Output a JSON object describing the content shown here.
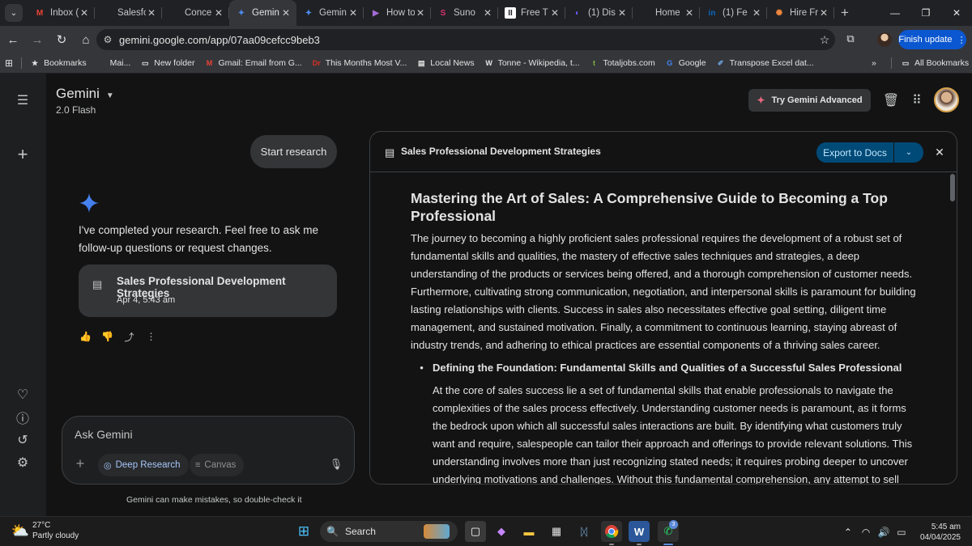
{
  "browser": {
    "tabs": [
      {
        "title": "Inbox (",
        "favicon": "M",
        "color": "#ea4335"
      },
      {
        "title": "Salesfo",
        "favicon": "",
        "color": "#202124"
      },
      {
        "title": "Conce",
        "favicon": "",
        "color": "#202124"
      },
      {
        "title": "Gemin",
        "favicon": "✦",
        "color": "#4c8df6",
        "active": true
      },
      {
        "title": "Gemin",
        "favicon": "✦",
        "color": "#4c8df6"
      },
      {
        "title": "How to",
        "favicon": "▶",
        "color": "#a46bd6"
      },
      {
        "title": "Suno",
        "favicon": "S",
        "color": "#d6336c"
      },
      {
        "title": "Free T",
        "favicon": "II",
        "color": "#ffffff"
      },
      {
        "title": "(1) Dis",
        "favicon": "◐",
        "color": "#6a5cff"
      },
      {
        "title": "Home",
        "favicon": "𝕏",
        "color": "#202124"
      },
      {
        "title": "(1) Fe",
        "favicon": "in",
        "color": "#0a66c2"
      },
      {
        "title": "Hire Fr",
        "favicon": "✺",
        "color": "#f0883e"
      }
    ],
    "url": "gemini.google.com/app/07aa09cefcc9beb3",
    "finish_update": "Finish update",
    "bookmarks": [
      {
        "label": "Bookmarks",
        "icon": "★",
        "color": "#e3e3e3"
      },
      {
        "label": "Mai...",
        "icon": "",
        "color": "#35363a"
      },
      {
        "label": "New folder",
        "icon": "▭",
        "color": "#e3e3e3"
      },
      {
        "label": "Gmail: Email from G...",
        "icon": "M",
        "color": "#ea4335"
      },
      {
        "label": "This Months Most V...",
        "icon": "Dr",
        "color": "#d93025"
      },
      {
        "label": "Local News",
        "icon": "▤",
        "color": "#e3e3e3"
      },
      {
        "label": "Tonne - Wikipedia, t...",
        "icon": "W",
        "color": "#e3e3e3"
      },
      {
        "label": "Totaljobs.com",
        "icon": "t",
        "color": "#7cb342"
      },
      {
        "label": "Google",
        "icon": "G",
        "color": "#4285f4"
      },
      {
        "label": "Transpose Excel dat...",
        "icon": "✐",
        "color": "#6aa0d8"
      }
    ],
    "bookmarks_more": "»",
    "all_bookmarks": "All Bookmarks"
  },
  "app": {
    "brand": "Gemini",
    "model": "2.0 Flash",
    "try_advanced": "Try Gemini Advanced"
  },
  "chat": {
    "user_message": "Start research",
    "reply": "I've completed your research. Feel free to ask me follow-up questions or request changes.",
    "doc_card": {
      "title": "Sales Professional Development Strategies",
      "date": "Apr 4, 5:43 am"
    },
    "input_placeholder": "Ask Gemini",
    "deep_research": "Deep Research",
    "canvas": "Canvas",
    "disclaimer": "Gemini can make mistakes, so double-check it"
  },
  "panel": {
    "title": "Sales Professional Development Strategies",
    "export": "Export to Docs",
    "heading": "Mastering the Art of Sales: A Comprehensive Guide to Becoming a Top Professional",
    "intro": "The journey to becoming a highly proficient sales professional requires the development of a robust set of fundamental skills and qualities, the mastery of effective sales techniques and strategies, a deep understanding of the products or services being offered, and a thorough comprehension of customer needs. Furthermore, cultivating strong communication, negotiation, and interpersonal skills is paramount for building lasting relationships with clients. Success in sales also necessitates effective goal setting, diligent time management, and sustained motivation. Finally, a commitment to continuous learning, staying abreast of industry trends, and adhering to ethical practices are essential components of a thriving sales career.",
    "bullet_heading": "Defining the Foundation: Fundamental Skills and Qualities of a Successful Sales Professional",
    "bullet_body": "At the core of sales success lie a set of fundamental skills that enable professionals to navigate the complexities of the sales process effectively. Understanding customer needs is paramount, as it forms the bedrock upon which all successful sales interactions are built. By identifying what customers truly want and require, salespeople can tailor their approach and offerings to provide relevant solutions. This understanding involves more than just recognizing stated needs; it requires probing deeper to uncover underlying motivations and challenges. Without this fundamental comprehension, any attempt to sell"
  },
  "taskbar": {
    "temp": "27°C",
    "condition": "Partly cloudy",
    "search": "Search",
    "time": "5:45 am",
    "date": "04/04/2025",
    "whatsapp_badge": "3"
  }
}
